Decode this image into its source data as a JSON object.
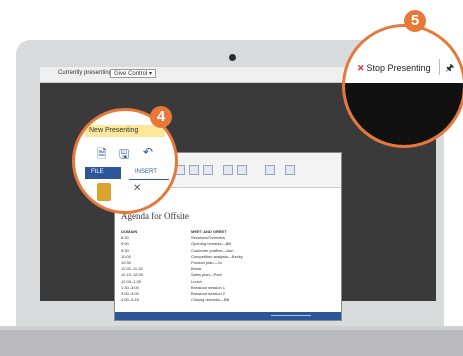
{
  "presenter_bar": {
    "status_label": "Currently presenting",
    "give_control_label": "Give Control ▾"
  },
  "stop_presenting": {
    "label": "Stop Presenting",
    "icon": "close-icon",
    "pin_icon": "pin-icon"
  },
  "callouts": {
    "four": "4",
    "five": "5",
    "color": "#e8783a"
  },
  "ribbon_zoom": {
    "new_presenting_label": "New Presenting",
    "file_tab": "FILE",
    "insert_tab": "INSERT"
  },
  "document": {
    "title": "Agenda for Offsite",
    "columns": [
      "DOMAIN",
      "MEET AND GREET"
    ],
    "rows": [
      [
        "8:30",
        "Sessions/Overview"
      ],
      [
        "9:00",
        "Opening remarks—Bill"
      ],
      [
        "9:30",
        "Customer profiles—Ann"
      ],
      [
        "10:00",
        "Competition analysis—Becky"
      ],
      [
        "10:30",
        "Product plan—Jo"
      ],
      [
        "11:00–11:15",
        "Break"
      ],
      [
        "11:15–12:00",
        "Sales plan—Pam"
      ],
      [
        "12:00–1:30",
        "Lunch"
      ],
      [
        "1:30–3:00",
        "Breakout session 1"
      ],
      [
        "3:00–4:00",
        "Breakout session 2"
      ],
      [
        "4:00–4:45",
        "Closing remarks—Bill"
      ]
    ]
  }
}
